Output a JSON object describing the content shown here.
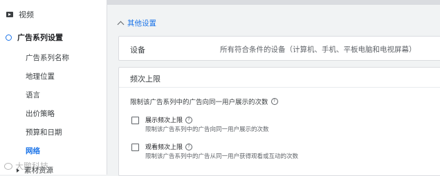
{
  "sidebar": {
    "video_label": "视频",
    "campaign_settings_label": "广告系列设置",
    "sub_items": [
      {
        "label": "广告系列名称",
        "active": false
      },
      {
        "label": "地理位置",
        "active": false
      },
      {
        "label": "语言",
        "active": false
      },
      {
        "label": "出价策略",
        "active": false
      },
      {
        "label": "预算和日期",
        "active": false
      },
      {
        "label": "网络",
        "active": true
      }
    ],
    "bottom_item": "素材资源",
    "watermark": "大鹏科技"
  },
  "main": {
    "other_settings_link": "其他设置",
    "device": {
      "label": "设备",
      "value": "所有符合条件的设备（计算机、手机、平板电脑和电视屏幕）"
    },
    "frequency_cap": {
      "title": "频次上限",
      "description": "限制该广告系列中的广告向同一用户展示的次数",
      "options": [
        {
          "title": "展示频次上限",
          "subtitle": "限制该广告系列中的广告向同一用户展示的次数"
        },
        {
          "title": "观看频次上限",
          "subtitle": "限制该广告系列中的广告从同一用户获得观看或互动的次数"
        }
      ]
    },
    "help_glyph": "?"
  },
  "colors": {
    "accent": "#1a73e8",
    "background": "#f1f3f4",
    "card": "#ffffff",
    "border": "#dadce0"
  }
}
